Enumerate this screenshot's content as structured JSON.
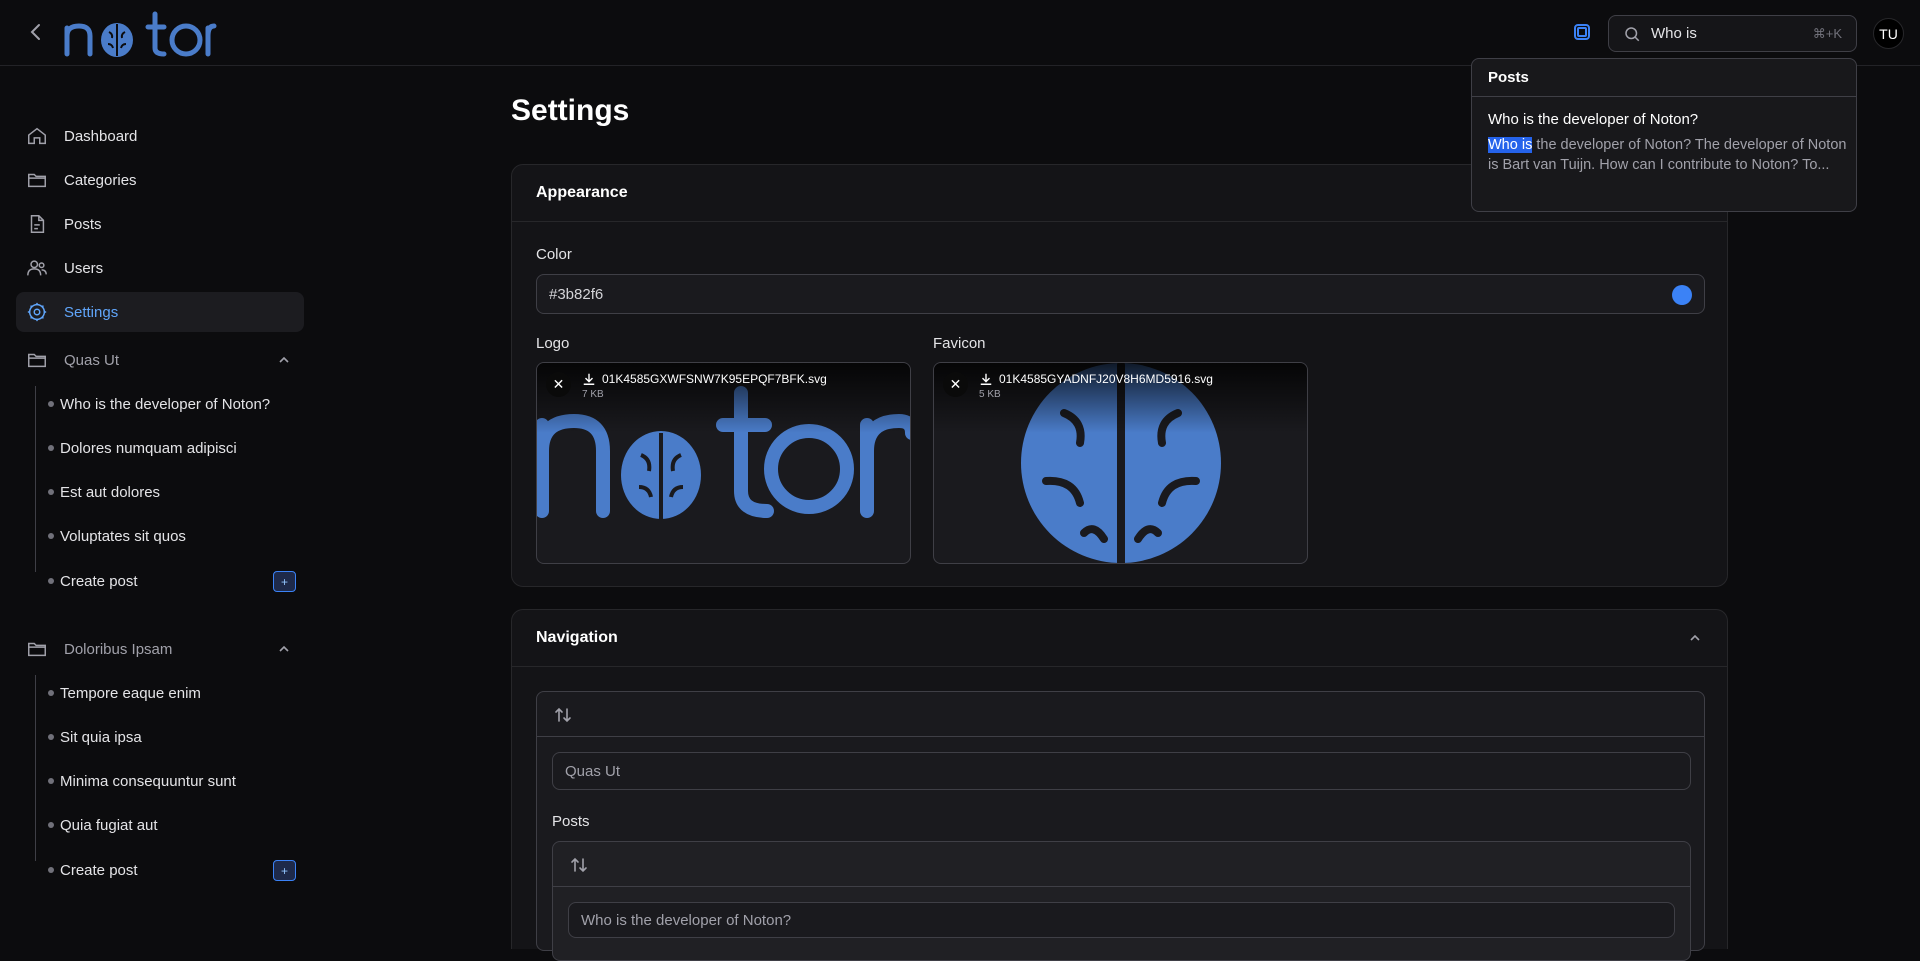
{
  "header": {
    "brand": "noton",
    "search_query": "Who is",
    "search_shortcut": "⌘+K",
    "avatar_initials": "TU"
  },
  "sidebar": {
    "items": [
      {
        "label": "Dashboard",
        "icon": "home-icon"
      },
      {
        "label": "Categories",
        "icon": "folder-icon"
      },
      {
        "label": "Posts",
        "icon": "file-icon"
      },
      {
        "label": "Users",
        "icon": "users-icon"
      },
      {
        "label": "Settings",
        "icon": "gear-icon",
        "active": true
      }
    ],
    "groups": [
      {
        "name": "Quas Ut",
        "posts": [
          "Who is the developer of Noton?",
          "Dolores numquam adipisci",
          "Est aut dolores",
          "Voluptates sit quos"
        ],
        "create_label": "Create post"
      },
      {
        "name": "Doloribus Ipsam",
        "posts": [
          "Tempore eaque enim",
          "Sit quia ipsa",
          "Minima consequuntur sunt",
          "Quia fugiat aut"
        ],
        "create_label": "Create post"
      }
    ],
    "plus_label": "+"
  },
  "main": {
    "title": "Settings",
    "appearance": {
      "heading": "Appearance",
      "color_label": "Color",
      "color_value": "#3b82f6",
      "logo_label": "Logo",
      "logo_file": "01K4585GXWFSNW7K95EPQF7BFK.svg",
      "logo_size": "7 KB",
      "favicon_label": "Favicon",
      "favicon_file": "01K4585GYADNFJ20V8H6MD5916.svg",
      "favicon_size": "5 KB",
      "remove_label": "✕"
    },
    "navigation": {
      "heading": "Navigation",
      "category_value": "Quas Ut",
      "posts_label": "Posts",
      "post_value": "Who is the developer of Noton?"
    }
  },
  "search_results": {
    "section": "Posts",
    "result_title": "Who is the developer of Noton?",
    "snippet_highlight": "Who is",
    "snippet_rest": " the developer of Noton? The developer of Noton is Bart van Tuijn. How can I contribute to Noton? To..."
  },
  "colors": {
    "accent": "#3b82f6",
    "background": "#0c0c0e",
    "card": "#141417"
  }
}
